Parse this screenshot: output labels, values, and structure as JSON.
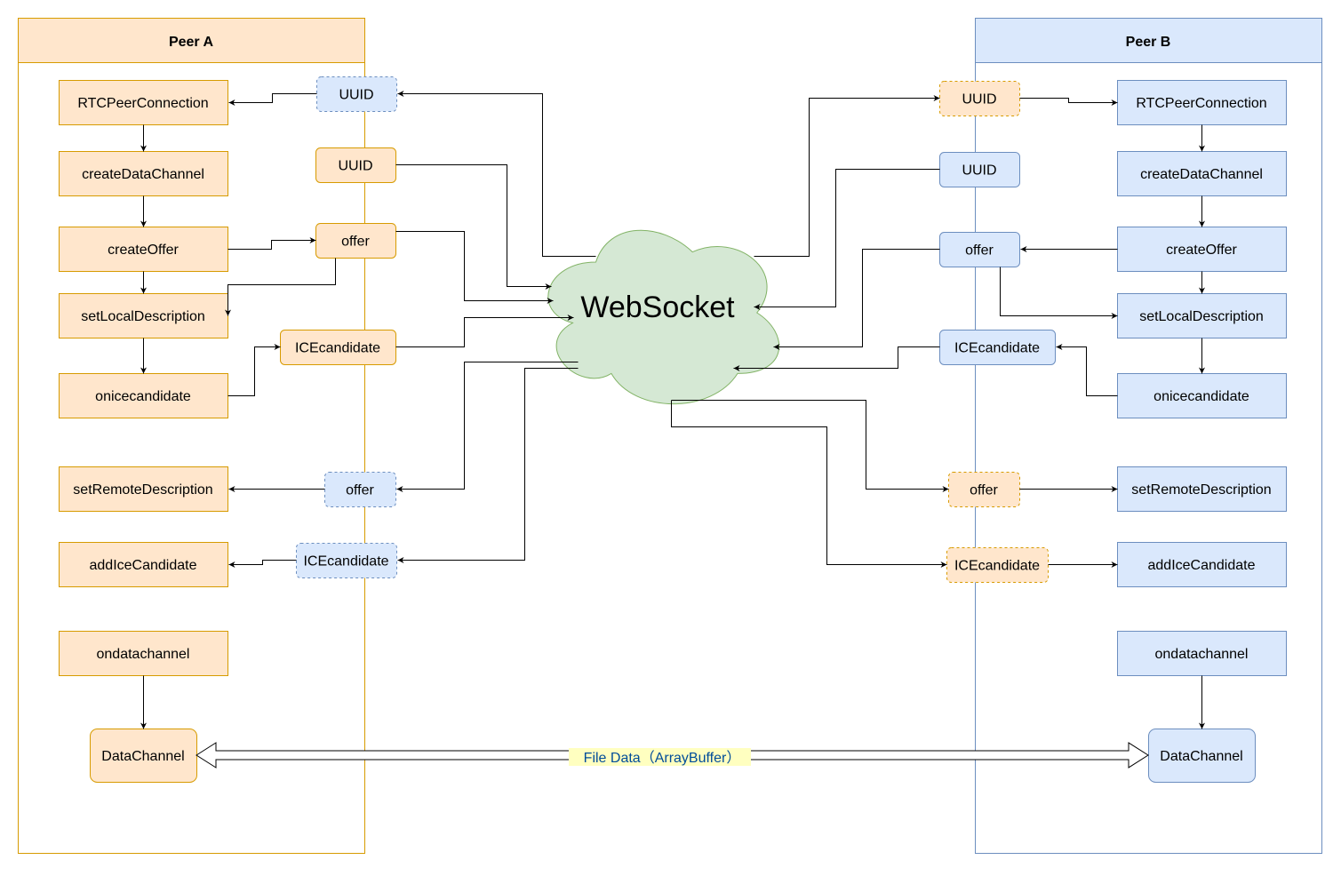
{
  "peer_a": {
    "title": "Peer A",
    "steps": [
      "RTCPeerConnection",
      "createDataChannel",
      "createOffer",
      "setLocalDescription",
      "onicecandidate",
      "setRemoteDescription",
      "addIceCandidate",
      "ondatachannel"
    ],
    "data_channel": "DataChannel",
    "messages": {
      "uuid_in": "UUID",
      "uuid_out": "UUID",
      "offer_out": "offer",
      "ice_out": "ICEcandidate",
      "offer_in": "offer",
      "ice_in": "ICEcandidate"
    }
  },
  "peer_b": {
    "title": "Peer B",
    "steps": [
      "RTCPeerConnection",
      "createDataChannel",
      "createOffer",
      "setLocalDescription",
      "onicecandidate",
      "setRemoteDescription",
      "addIceCandidate",
      "ondatachannel"
    ],
    "data_channel": "DataChannel",
    "messages": {
      "uuid_in": "UUID",
      "uuid_out": "UUID",
      "offer_out": "offer",
      "ice_out": "ICEcandidate",
      "offer_in": "offer",
      "ice_in": "ICEcandidate"
    }
  },
  "server": {
    "label": "WebSocket"
  },
  "transfer": {
    "label": "File Data（ArrayBuffer）"
  },
  "colors": {
    "orange_fill": "#ffe6cc",
    "orange_stroke": "#d79b00",
    "blue_fill": "#dae8fc",
    "blue_stroke": "#6c8ebf",
    "cloud_fill": "#d5e8d4",
    "cloud_stroke": "#82b366",
    "label_bg": "#ffffc0",
    "label_text": "#004c99"
  }
}
